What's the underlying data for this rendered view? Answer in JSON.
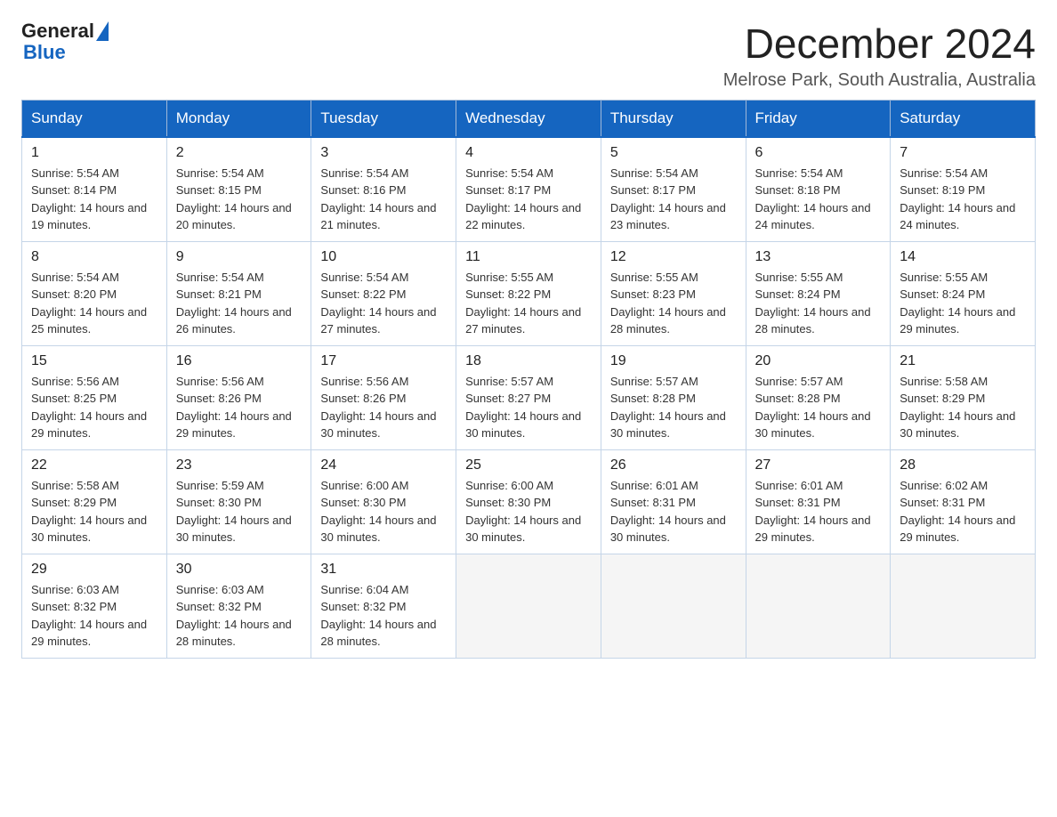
{
  "header": {
    "logo_general": "General",
    "logo_blue": "Blue",
    "main_title": "December 2024",
    "subtitle": "Melrose Park, South Australia, Australia"
  },
  "weekdays": [
    "Sunday",
    "Monday",
    "Tuesday",
    "Wednesday",
    "Thursday",
    "Friday",
    "Saturday"
  ],
  "weeks": [
    [
      {
        "day": "1",
        "sunrise": "5:54 AM",
        "sunset": "8:14 PM",
        "daylight": "14 hours and 19 minutes."
      },
      {
        "day": "2",
        "sunrise": "5:54 AM",
        "sunset": "8:15 PM",
        "daylight": "14 hours and 20 minutes."
      },
      {
        "day": "3",
        "sunrise": "5:54 AM",
        "sunset": "8:16 PM",
        "daylight": "14 hours and 21 minutes."
      },
      {
        "day": "4",
        "sunrise": "5:54 AM",
        "sunset": "8:17 PM",
        "daylight": "14 hours and 22 minutes."
      },
      {
        "day": "5",
        "sunrise": "5:54 AM",
        "sunset": "8:17 PM",
        "daylight": "14 hours and 23 minutes."
      },
      {
        "day": "6",
        "sunrise": "5:54 AM",
        "sunset": "8:18 PM",
        "daylight": "14 hours and 24 minutes."
      },
      {
        "day": "7",
        "sunrise": "5:54 AM",
        "sunset": "8:19 PM",
        "daylight": "14 hours and 24 minutes."
      }
    ],
    [
      {
        "day": "8",
        "sunrise": "5:54 AM",
        "sunset": "8:20 PM",
        "daylight": "14 hours and 25 minutes."
      },
      {
        "day": "9",
        "sunrise": "5:54 AM",
        "sunset": "8:21 PM",
        "daylight": "14 hours and 26 minutes."
      },
      {
        "day": "10",
        "sunrise": "5:54 AM",
        "sunset": "8:22 PM",
        "daylight": "14 hours and 27 minutes."
      },
      {
        "day": "11",
        "sunrise": "5:55 AM",
        "sunset": "8:22 PM",
        "daylight": "14 hours and 27 minutes."
      },
      {
        "day": "12",
        "sunrise": "5:55 AM",
        "sunset": "8:23 PM",
        "daylight": "14 hours and 28 minutes."
      },
      {
        "day": "13",
        "sunrise": "5:55 AM",
        "sunset": "8:24 PM",
        "daylight": "14 hours and 28 minutes."
      },
      {
        "day": "14",
        "sunrise": "5:55 AM",
        "sunset": "8:24 PM",
        "daylight": "14 hours and 29 minutes."
      }
    ],
    [
      {
        "day": "15",
        "sunrise": "5:56 AM",
        "sunset": "8:25 PM",
        "daylight": "14 hours and 29 minutes."
      },
      {
        "day": "16",
        "sunrise": "5:56 AM",
        "sunset": "8:26 PM",
        "daylight": "14 hours and 29 minutes."
      },
      {
        "day": "17",
        "sunrise": "5:56 AM",
        "sunset": "8:26 PM",
        "daylight": "14 hours and 30 minutes."
      },
      {
        "day": "18",
        "sunrise": "5:57 AM",
        "sunset": "8:27 PM",
        "daylight": "14 hours and 30 minutes."
      },
      {
        "day": "19",
        "sunrise": "5:57 AM",
        "sunset": "8:28 PM",
        "daylight": "14 hours and 30 minutes."
      },
      {
        "day": "20",
        "sunrise": "5:57 AM",
        "sunset": "8:28 PM",
        "daylight": "14 hours and 30 minutes."
      },
      {
        "day": "21",
        "sunrise": "5:58 AM",
        "sunset": "8:29 PM",
        "daylight": "14 hours and 30 minutes."
      }
    ],
    [
      {
        "day": "22",
        "sunrise": "5:58 AM",
        "sunset": "8:29 PM",
        "daylight": "14 hours and 30 minutes."
      },
      {
        "day": "23",
        "sunrise": "5:59 AM",
        "sunset": "8:30 PM",
        "daylight": "14 hours and 30 minutes."
      },
      {
        "day": "24",
        "sunrise": "6:00 AM",
        "sunset": "8:30 PM",
        "daylight": "14 hours and 30 minutes."
      },
      {
        "day": "25",
        "sunrise": "6:00 AM",
        "sunset": "8:30 PM",
        "daylight": "14 hours and 30 minutes."
      },
      {
        "day": "26",
        "sunrise": "6:01 AM",
        "sunset": "8:31 PM",
        "daylight": "14 hours and 30 minutes."
      },
      {
        "day": "27",
        "sunrise": "6:01 AM",
        "sunset": "8:31 PM",
        "daylight": "14 hours and 29 minutes."
      },
      {
        "day": "28",
        "sunrise": "6:02 AM",
        "sunset": "8:31 PM",
        "daylight": "14 hours and 29 minutes."
      }
    ],
    [
      {
        "day": "29",
        "sunrise": "6:03 AM",
        "sunset": "8:32 PM",
        "daylight": "14 hours and 29 minutes."
      },
      {
        "day": "30",
        "sunrise": "6:03 AM",
        "sunset": "8:32 PM",
        "daylight": "14 hours and 28 minutes."
      },
      {
        "day": "31",
        "sunrise": "6:04 AM",
        "sunset": "8:32 PM",
        "daylight": "14 hours and 28 minutes."
      },
      null,
      null,
      null,
      null
    ]
  ]
}
